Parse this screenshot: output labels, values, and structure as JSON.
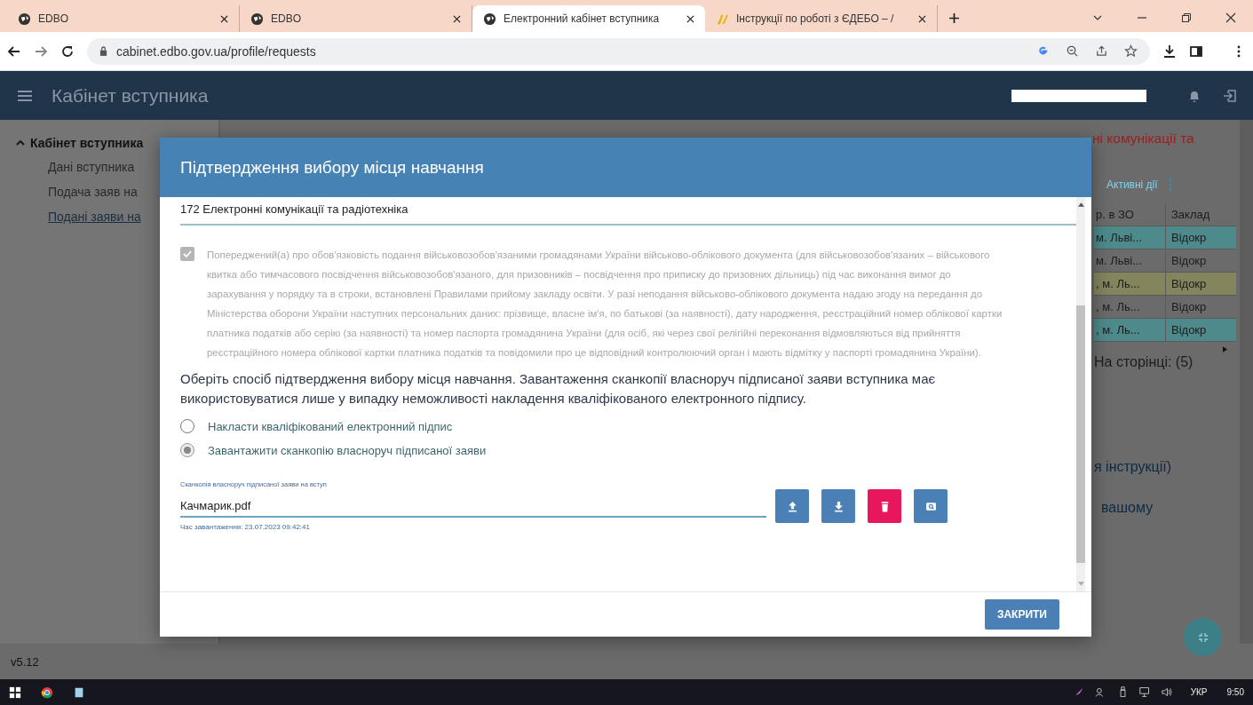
{
  "browser": {
    "tabs": [
      {
        "title": "EDBO",
        "selected": false,
        "kind": "site"
      },
      {
        "title": "EDBO",
        "selected": false,
        "kind": "site"
      },
      {
        "title": "Електронний кабінет вступника",
        "selected": true,
        "kind": "site"
      },
      {
        "title": "Інструкції по роботі з ЄДЕБО – /",
        "selected": false,
        "kind": "docs"
      }
    ],
    "url": "cabinet.edbo.gov.ua/profile/requests"
  },
  "app": {
    "title": "Кабінет вступника"
  },
  "sidebar": {
    "group": {
      "label": "Кабінет вступника",
      "expanded": true
    },
    "items": [
      {
        "label": "Дані вступника",
        "selected": false
      },
      {
        "label": "Подача заяв на",
        "selected": false
      },
      {
        "label": "Подані заяви на",
        "selected": true
      }
    ]
  },
  "background": {
    "notice_fragment": "ні комунікації та",
    "actions_label": "Активні дії",
    "table": {
      "columns": [
        "р. в ЗО",
        "Заклад"
      ],
      "rows": [
        {
          "cells": [
            "м. Льві...",
            "Відокр"
          ],
          "color": "#4e898b"
        },
        {
          "cells": [
            "м. Льві...",
            "Відокр"
          ],
          "color": "#6b6b6b"
        },
        {
          "cells": [
            ", м. Ль...",
            "Відокр"
          ],
          "color": "#84855d"
        },
        {
          "cells": [
            ", м. Ль...",
            "Відокр"
          ],
          "color": "#6b6b6b"
        },
        {
          "cells": [
            ", м. Ль...",
            "Відокр"
          ],
          "color": "#4e898b"
        }
      ]
    },
    "page_size": "На сторінці: (5)",
    "fragments": [
      "я інструкції)",
      "вашому"
    ],
    "version": "v5.12"
  },
  "dialog": {
    "title": "Підтвердження вибору місця навчання",
    "specialty": "172 Електронні комунікації та радіотехніка",
    "warning": {
      "checked": true,
      "disabled": true,
      "text": "Попереджений(а) про обов'язковість подання військовозобов'язаними громадянами України військово-облікового документа (для військовозобов'язаних – військового квитка або тимчасового посвідчення військовозобов'язаного, для призовників – посвідчення про приписку до призовних дільниць) під час виконання вимог до зарахування у порядку та в строки, встановлені Правилами прийому закладу освіти. У разі неподання військово-облікового документа надаю згоду на передання до Міністерства оборони України наступних персональних даних: прізвище, власне ім'я, по батькові (за наявності), дату народження, реєстраційний номер облікової картки платника податків або серію (за наявності) та номер паспорта громадянина України (для осіб, які через свої релігійні переконання відмовляються від прийняття реєстраційного номера облікової картки платника податків та повідомили про це відповідний контролюючий орган і мають відмітку у паспорті громадянина України)."
    },
    "instruction": "Оберіть спосіб підтвердження вибору місця навчання. Завантаження сканкопії власноруч підписаної заяви вступника має використовуватися лише у випадку неможливості накладення кваліфікованого електронного підпису.",
    "options": [
      {
        "label": "Накласти кваліфікований електронний підпис",
        "selected": false
      },
      {
        "label": "Завантажити сканкопію власноруч підписаної заяви",
        "selected": true
      }
    ],
    "file": {
      "label": "Сканкопія власноруч підписаної заяви на вступ",
      "value": "Качмарик.pdf",
      "hint": "Час завантаження: 23.07.2023 09:42:41"
    },
    "file_actions": [
      {
        "kind": "upload"
      },
      {
        "kind": "download"
      },
      {
        "kind": "delete"
      },
      {
        "kind": "preview"
      }
    ],
    "close_button": "ЗАКРИТИ"
  },
  "taskbar": {
    "language": "УКР",
    "time": "9:50"
  }
}
